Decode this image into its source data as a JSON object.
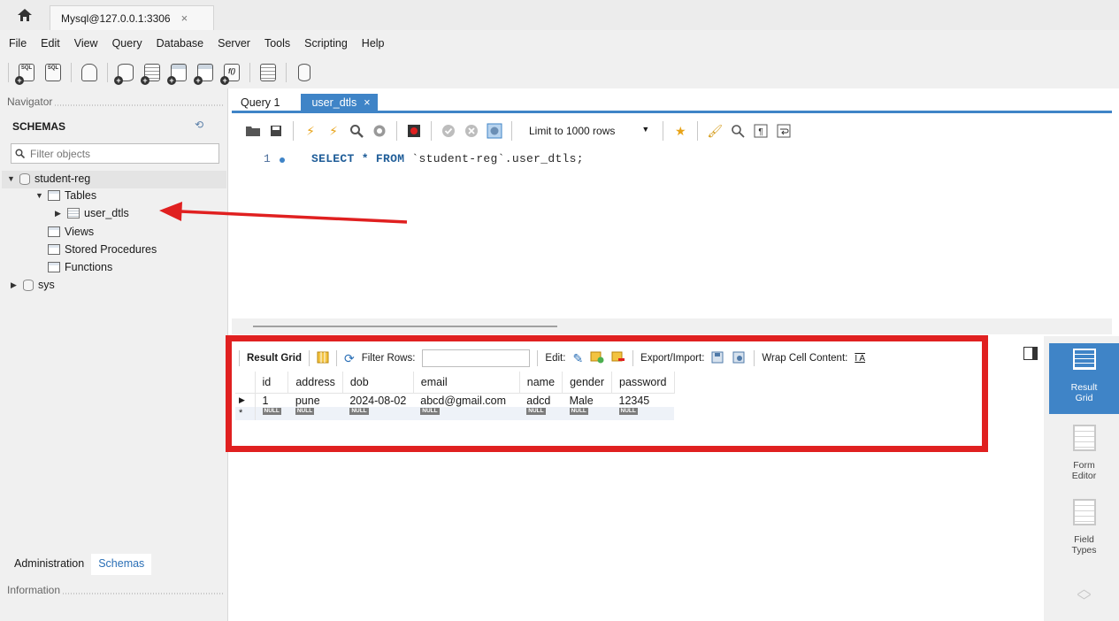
{
  "window": {
    "connection_tab": "Mysql@127.0.0.1:3306",
    "close_glyph": "×"
  },
  "menu": [
    "File",
    "Edit",
    "View",
    "Query",
    "Database",
    "Server",
    "Tools",
    "Scripting",
    "Help"
  ],
  "navigator": {
    "header": "Navigator",
    "schemas_title": "SCHEMAS",
    "filter_placeholder": "Filter objects",
    "tree": {
      "schema1": "student-reg",
      "tables": "Tables",
      "table1": "user_dtls",
      "views": "Views",
      "procedures": "Stored Procedures",
      "functions": "Functions",
      "schema2": "sys"
    },
    "bottom_tabs": {
      "administration": "Administration",
      "schemas": "Schemas"
    },
    "info_header": "Information"
  },
  "editor": {
    "tabs": {
      "query1": "Query 1",
      "active": "user_dtls"
    },
    "limit_label": "Limit to 1000 rows",
    "line_number": "1",
    "sql_keywords": "SELECT * FROM ",
    "sql_rest": "`student-reg`.user_dtls;"
  },
  "results": {
    "result_grid_label": "Result Grid",
    "filter_rows_label": "Filter Rows:",
    "edit_label": "Edit:",
    "export_label": "Export/Import:",
    "wrap_label": "Wrap Cell Content:",
    "columns": [
      "id",
      "address",
      "dob",
      "email",
      "name",
      "gender",
      "password"
    ],
    "rows": [
      [
        "1",
        "pune",
        "2024-08-02",
        "abcd@gmail.com",
        "adcd",
        "Male",
        "12345"
      ]
    ],
    "null_badge": "NULL",
    "new_row_marker": "*"
  },
  "side_panel": {
    "result_grid": [
      "Result",
      "Grid"
    ],
    "form_editor": [
      "Form",
      "Editor"
    ],
    "field_types": [
      "Field",
      "Types"
    ]
  },
  "colors": {
    "accent": "#3f84c7",
    "annotation": "#e02020"
  }
}
